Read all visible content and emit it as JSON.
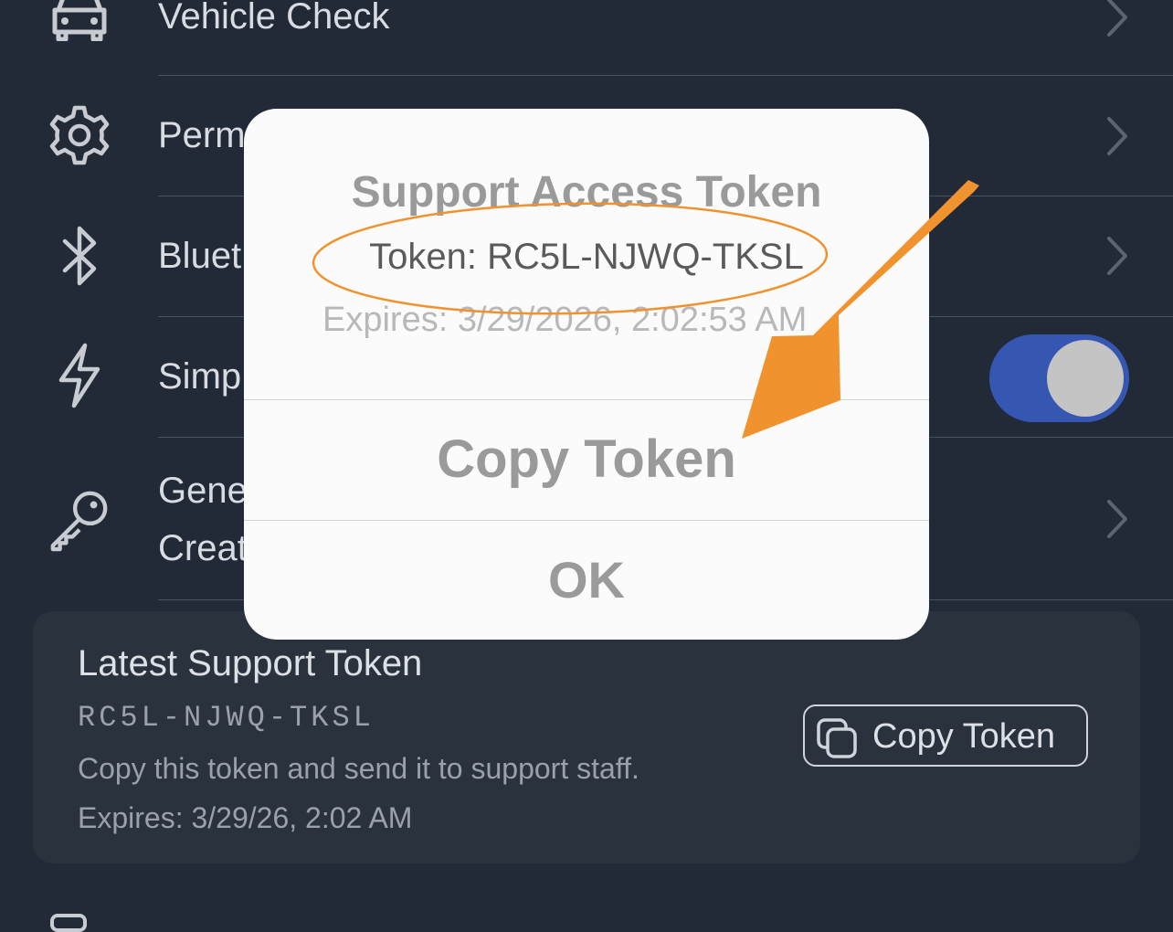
{
  "settings": {
    "rows": [
      {
        "label": "Vehicle Check",
        "icon": "car-icon"
      },
      {
        "label": "Perm",
        "icon": "gear-icon"
      },
      {
        "label": "Bluet",
        "icon": "bluetooth-icon"
      },
      {
        "label": "Simp",
        "icon": "bolt-icon"
      },
      {
        "label": "Gene",
        "sublabel": "Creat",
        "icon": "key-icon"
      }
    ]
  },
  "latest_token_card": {
    "title": "Latest Support Token",
    "token": "RC5L-NJWQ-TKSL",
    "hint": "Copy this token and send it to support staff.",
    "expires": "Expires: 3/29/26, 2:02 AM",
    "copy_button": "Copy Token"
  },
  "dialog": {
    "title": "Support Access Token",
    "token_line": "Token: RC5L-NJWQ-TKSL",
    "expires": "Expires: 3/29/2026, 2:02:53 AM",
    "copy_button": "Copy Token",
    "ok_button": "OK"
  },
  "colors": {
    "background": "#212a36",
    "toggle_on": "#3657b1",
    "annotation": "#f0922e"
  }
}
